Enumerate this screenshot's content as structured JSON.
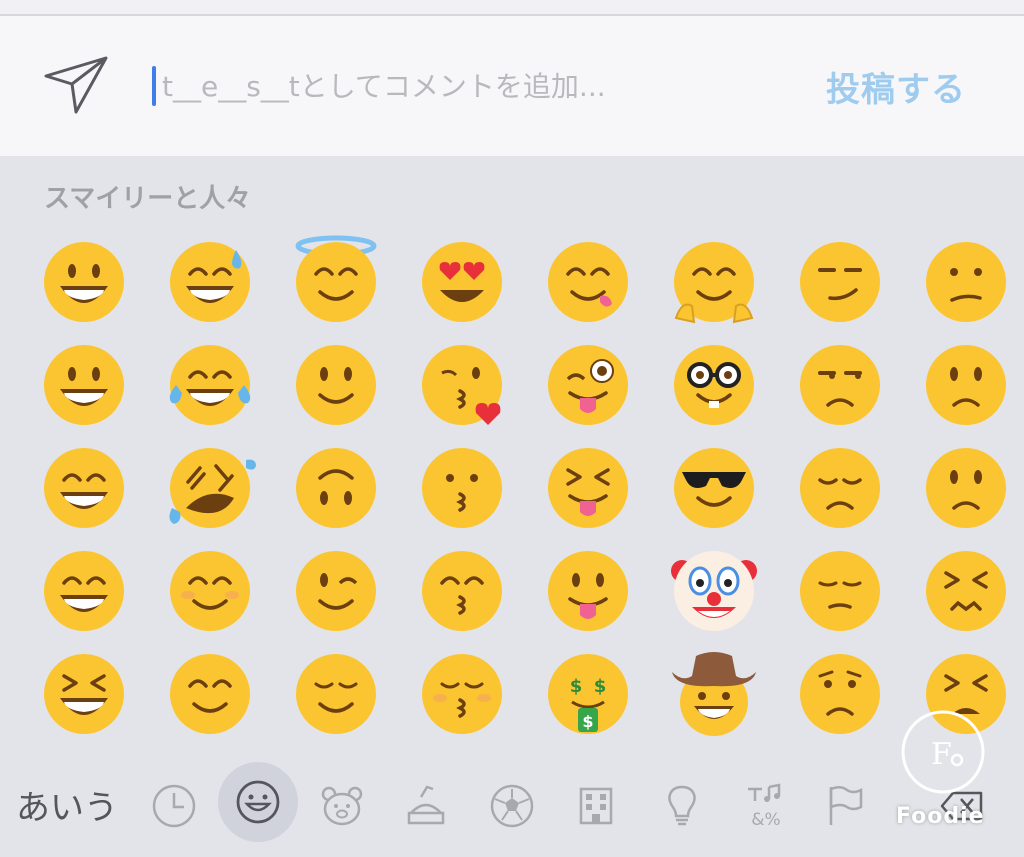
{
  "comment_bar": {
    "placeholder": "t__e__s__tとしてコメントを追加...",
    "post_label": "投稿する"
  },
  "emoji_panel": {
    "category_title": "スマイリーと人々",
    "emojis": [
      "grinning-face",
      "grinning-face-with-sweat",
      "smiling-face-with-halo",
      "smiling-face-with-heart-eyes",
      "face-savoring-food",
      "hugging-face",
      "smirking-face",
      "confused-face",
      "grinning-face-big-eyes",
      "face-with-tears-of-joy",
      "slightly-smiling-face",
      "face-blowing-a-kiss",
      "winking-face-with-tongue",
      "nerd-face",
      "unamused-face",
      "slightly-frowning-face",
      "grinning-face-smiling-eyes",
      "rolling-on-the-floor-laughing",
      "upside-down-face",
      "kissing-face",
      "squinting-face-with-tongue",
      "smiling-face-with-sunglasses",
      "disappointed-face",
      "frowning-face",
      "beaming-face",
      "smiling-face",
      "winking-face",
      "kissing-face-with-smiling-eyes",
      "face-with-tongue",
      "clown-face",
      "pensive-face",
      "confounded-face",
      "grinning-squinting-face",
      "smiling-face-with-smiling-eyes",
      "relieved-face",
      "kissing-face-with-closed-eyes",
      "money-mouth-face",
      "cowboy-hat-face",
      "worried-face",
      "tired-face"
    ]
  },
  "keyboard_bar": {
    "kana_label": "あいう",
    "tabs": [
      "recent-icon",
      "smiley-icon",
      "animal-icon",
      "food-icon",
      "activity-icon",
      "travel-icon",
      "objects-icon",
      "symbols-icon",
      "flags-icon",
      "delete-icon"
    ],
    "symbols_text": "&%"
  },
  "watermark": {
    "text": "Foodie"
  },
  "colors": {
    "accent": "#9ecbee",
    "cursor": "#3f7ee9",
    "emoji_yellow": "#fbc531",
    "background": "#e3e4e9"
  }
}
